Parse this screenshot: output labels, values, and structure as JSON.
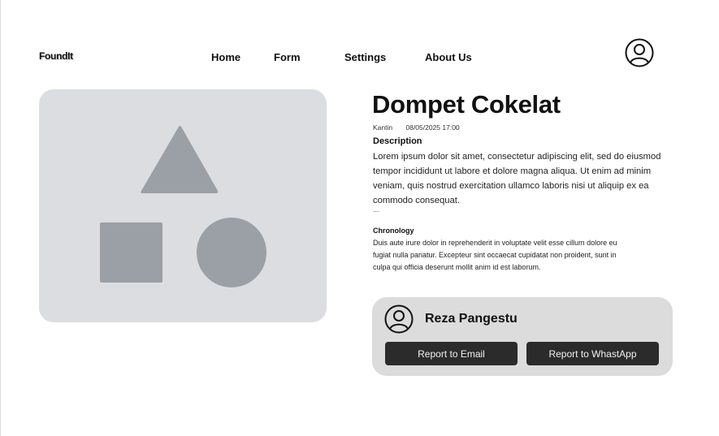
{
  "header": {
    "logo": "FoundIt",
    "nav": [
      {
        "label": "Home"
      },
      {
        "label": "Form"
      },
      {
        "label": "Settings"
      },
      {
        "label": "About Us"
      }
    ],
    "profile_icon": "user-circle-icon"
  },
  "media": {
    "placeholder_icon": "shapes-placeholder-icon"
  },
  "item": {
    "title": "Dompet Cokelat",
    "location": "Kantin",
    "datetime": "08/05/2025 17:00",
    "description_heading": "Description",
    "description": "Lorem ipsum dolor sit amet, consectetur adipiscing elit, sed do eiusmod tempor incididunt ut labore et dolore magna aliqua. Ut enim ad minim veniam, quis nostrud exercitation ullamco laboris nisi ut aliquip ex ea commodo consequat.",
    "ellipsis": "...",
    "chronology_heading": "Chronology",
    "chronology": "Duis aute irure dolor in reprehenderit in voluptate velit esse cillum dolore eu fugiat nulla pariatur. Excepteur sint occaecat cupidatat non proident, sunt in culpa qui officia deserunt mollit anim id est laborum."
  },
  "reporter": {
    "name": "Reza Pangestu",
    "avatar_icon": "user-circle-icon",
    "email_button": "Report to Email",
    "whatsapp_button": "Report to WhastApp"
  },
  "colors": {
    "placeholder_bg": "#dcdde0",
    "placeholder_shape": "#9aa0a6",
    "card_bg": "#dcdcdc",
    "button_bg": "#2b2b2b"
  }
}
